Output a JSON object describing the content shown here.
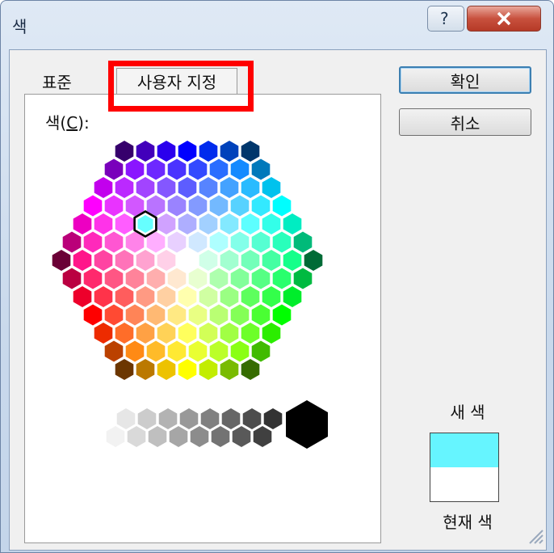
{
  "window": {
    "title": "색"
  },
  "titlebar": {
    "help_icon": "question-icon",
    "close_icon": "close-icon"
  },
  "tabs": [
    {
      "label": "표준"
    },
    {
      "label": "사용자 지정",
      "highlighted": true
    }
  ],
  "color_label_prefix": "색(",
  "color_label_key": "C",
  "color_label_suffix": "):",
  "buttons": {
    "ok": "확인",
    "cancel": "취소"
  },
  "new_color_label": "새 색",
  "current_color_label": "현재 색",
  "colors": {
    "highlight_border": "#ff0000",
    "new_color": "#66f5ff",
    "current_color": "#ffffff"
  },
  "selected_color": "#66ffff"
}
